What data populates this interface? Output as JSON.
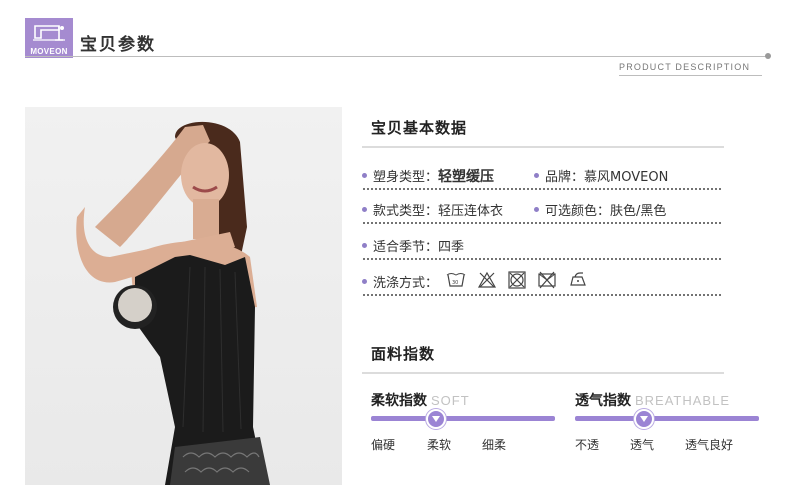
{
  "brand": {
    "logo_text": "MOVEON"
  },
  "header": {
    "title": "宝贝参数",
    "subtitle": "PRODUCT DESCRIPTION"
  },
  "basic": {
    "title": "宝贝基本数据",
    "rows": [
      {
        "label": "塑身类型：",
        "value": "轻塑缓压",
        "label2": "品牌：",
        "value2": "慕风MOVEON"
      },
      {
        "label": "款式类型：",
        "value": "轻压连体衣",
        "label2": "可选颜色：",
        "value2": "肤色/黑色"
      },
      {
        "label": "适合季节：",
        "value": "四季"
      },
      {
        "label": "洗涤方式：",
        "icons": [
          "wash-30-icon",
          "no-bleach-icon",
          "no-tumble-dry-icon",
          "no-dry-clean-icon",
          "low-iron-icon"
        ]
      }
    ]
  },
  "fabric": {
    "title": "面料指数",
    "softness": {
      "label": "柔软指数",
      "en": "SOFT",
      "scale": [
        "偏硬",
        "柔软",
        "细柔"
      ],
      "selected_index": 1
    },
    "breathability": {
      "label": "透气指数",
      "en": "BREATHABLE",
      "scale": [
        "不透",
        "透气",
        "透气良好"
      ],
      "selected_index": 1
    }
  },
  "colors": {
    "accent": "#9b84d4",
    "logo_bg": "#a58bd0"
  }
}
